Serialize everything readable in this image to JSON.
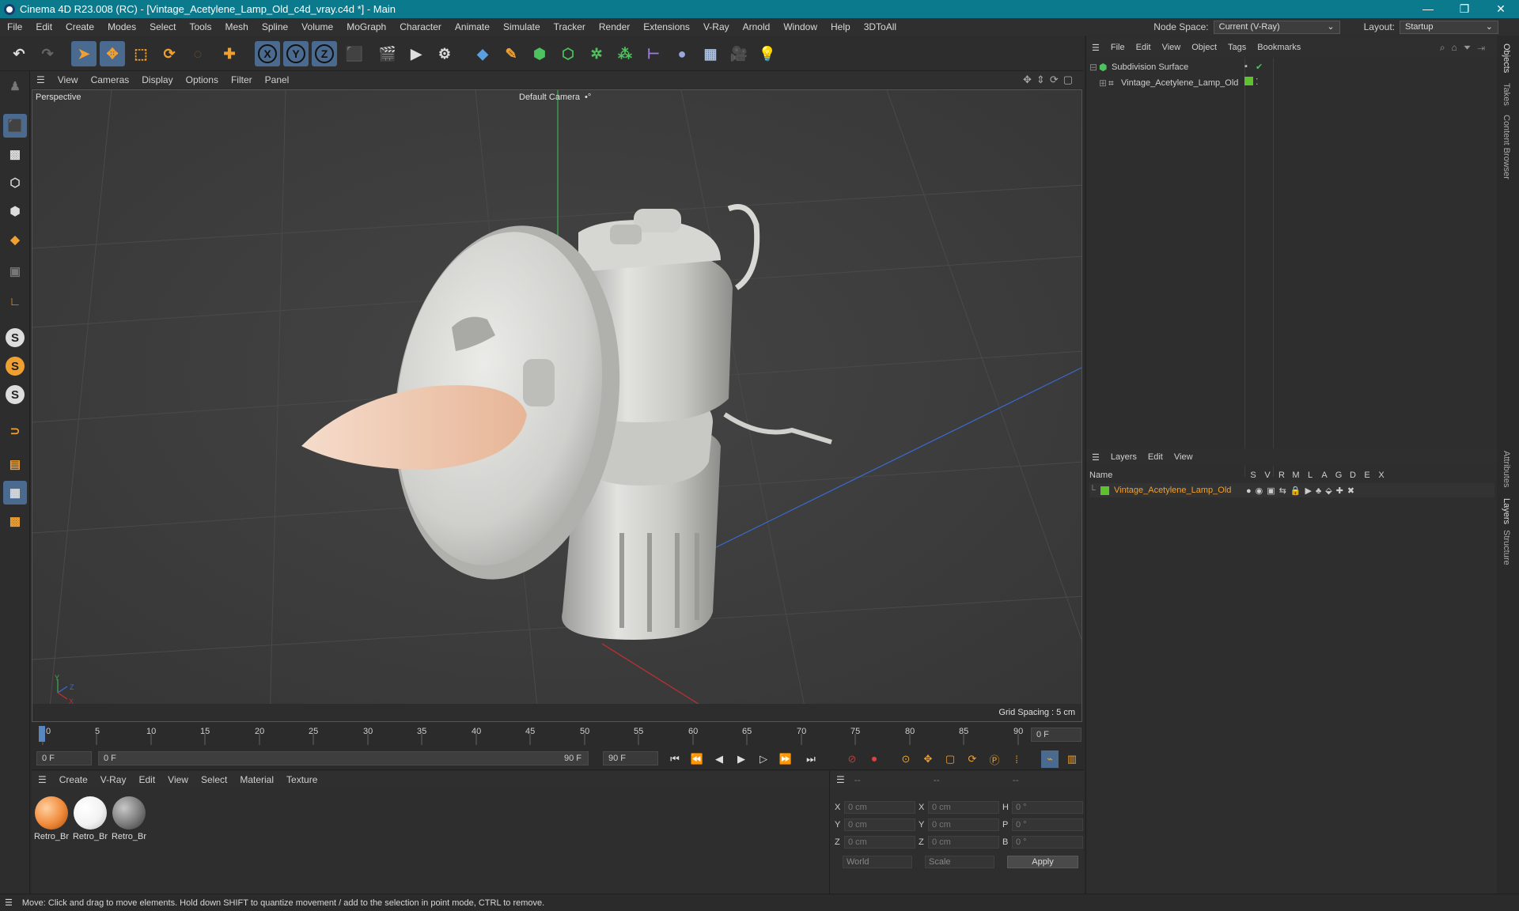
{
  "window": {
    "title": "Cinema 4D R23.008 (RC) - [Vintage_Acetylene_Lamp_Old_c4d_vray.c4d *] - Main",
    "controls": [
      "—",
      "❐",
      "✕"
    ]
  },
  "menubar": {
    "items": [
      "File",
      "Edit",
      "Create",
      "Modes",
      "Select",
      "Tools",
      "Mesh",
      "Spline",
      "Volume",
      "MoGraph",
      "Character",
      "Animate",
      "Simulate",
      "Tracker",
      "Render",
      "Extensions",
      "V-Ray",
      "Arnold",
      "Window",
      "Help",
      "3DToAll"
    ],
    "node_space_label": "Node Space:",
    "node_space_value": "Current (V-Ray)",
    "layout_label": "Layout:",
    "layout_value": "Startup"
  },
  "toolbar": {
    "axis_x": "X",
    "axis_y": "Y",
    "axis_z": "Z"
  },
  "viewport": {
    "menu": [
      "View",
      "Cameras",
      "Display",
      "Options",
      "Filter",
      "Panel"
    ],
    "projection": "Perspective",
    "camera": "Default Camera",
    "camera_suffix": "•°",
    "grid_spacing": "Grid Spacing : 5 cm",
    "axis_labels": {
      "y": "Y",
      "z": "Z",
      "x": "X"
    }
  },
  "timeline": {
    "ticks": [
      "0",
      "5",
      "10",
      "15",
      "20",
      "25",
      "30",
      "35",
      "40",
      "45",
      "50",
      "55",
      "60",
      "65",
      "70",
      "75",
      "80",
      "85",
      "90"
    ],
    "current_frame": "0 F"
  },
  "transport": {
    "start_field": "0 F",
    "range_start": "0 F",
    "range_end": "90 F",
    "end_field": "90 F"
  },
  "materials": {
    "menu": [
      "Create",
      "V-Ray",
      "Edit",
      "View",
      "Select",
      "Material",
      "Texture"
    ],
    "items": [
      {
        "label": "Retro_Br",
        "color": "#f08a3a"
      },
      {
        "label": "Retro_Br",
        "color": "#ffffff"
      },
      {
        "label": "Retro_Br",
        "color": "#7a7a7a"
      }
    ]
  },
  "coordinates": {
    "headers": [
      "--",
      "--",
      "--"
    ],
    "rows": [
      {
        "a": "X",
        "av": "0 cm",
        "b": "X",
        "bv": "0 cm",
        "c": "H",
        "cv": "0 °"
      },
      {
        "a": "Y",
        "av": "0 cm",
        "b": "Y",
        "bv": "0 cm",
        "c": "P",
        "cv": "0 °"
      },
      {
        "a": "Z",
        "av": "0 cm",
        "b": "Z",
        "bv": "0 cm",
        "c": "B",
        "cv": "0 °"
      }
    ],
    "space": "World",
    "mode": "Scale",
    "apply": "Apply"
  },
  "objects_panel": {
    "menu": [
      "File",
      "Edit",
      "View",
      "Object",
      "Tags",
      "Bookmarks"
    ],
    "items": [
      {
        "name": "Subdivision Surface"
      },
      {
        "name": "Vintage_Acetylene_Lamp_Old"
      }
    ]
  },
  "layers_panel": {
    "menu": [
      "Layers",
      "Edit",
      "View"
    ],
    "columns": [
      "Name",
      "S",
      "V",
      "R",
      "M",
      "L",
      "A",
      "G",
      "D",
      "E",
      "X"
    ],
    "items": [
      {
        "name": "Vintage_Acetylene_Lamp_Old",
        "color": "#5ec22e"
      }
    ]
  },
  "side_tabs": [
    "Objects",
    "Takes",
    "Content Browser",
    "Attributes",
    "Layers",
    "Structure"
  ],
  "status": {
    "text": "Move: Click and drag to move elements. Hold down SHIFT to quantize movement / add to the selection in point mode, CTRL to remove."
  }
}
